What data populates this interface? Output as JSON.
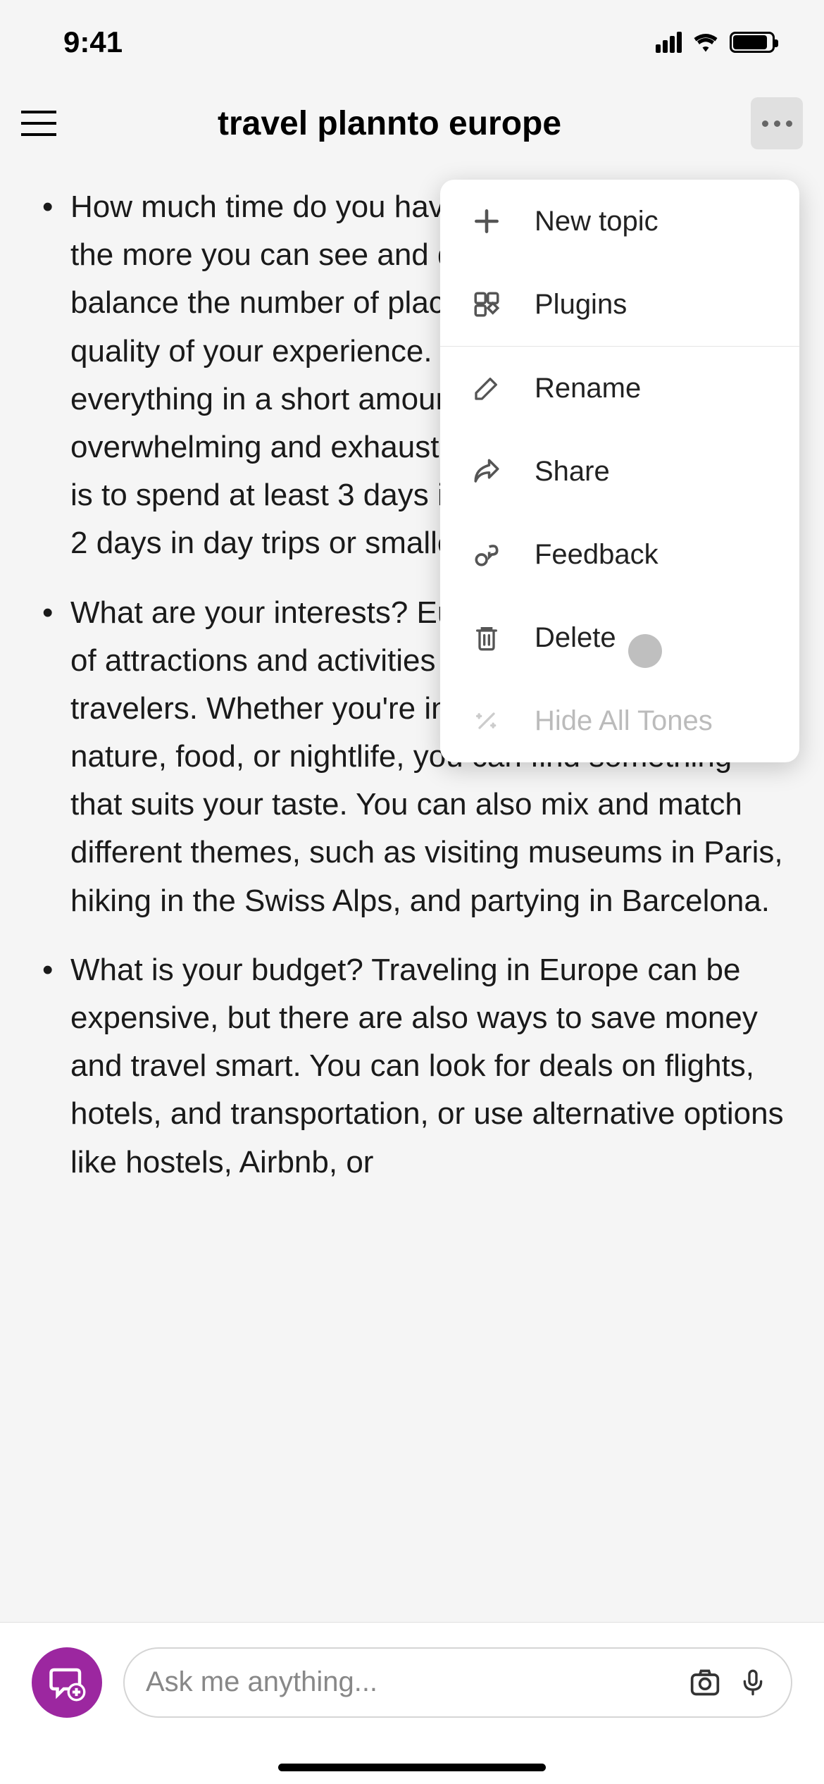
{
  "status": {
    "time": "9:41"
  },
  "header": {
    "title": "travel plannto europe"
  },
  "content": {
    "bullets": [
      "How much time do you have? The longer you stay, the more you can see and do, but you also need to balance the number of places you visit with the quality of your experience. Don't try to see everything in a short amount, as it can be overwhelming and exhausting. A good rule of thumb is to spend at least 3 days in each major city, and 1-2 days in day trips or smaller towns.",
      "What are your interests? Europe has a wide variety of attractions and activities for different types of travelers. Whether you're into art, history, culture, nature, food, or nightlife, you can find something that suits your taste. You can also mix and match different themes, such as visiting museums in Paris, hiking in the Swiss Alps, and partying in Barcelona.",
      "What is your budget? Traveling in Europe can be expensive, but there are also ways to save money and travel smart. You can look for deals on flights, hotels, and transportation, or use alternative options like hostels, Airbnb, or"
    ]
  },
  "menu": {
    "new_topic": "New topic",
    "plugins": "Plugins",
    "rename": "Rename",
    "share": "Share",
    "feedback": "Feedback",
    "delete": "Delete",
    "hide_tones": "Hide All Tones"
  },
  "input": {
    "placeholder": "Ask me anything..."
  }
}
